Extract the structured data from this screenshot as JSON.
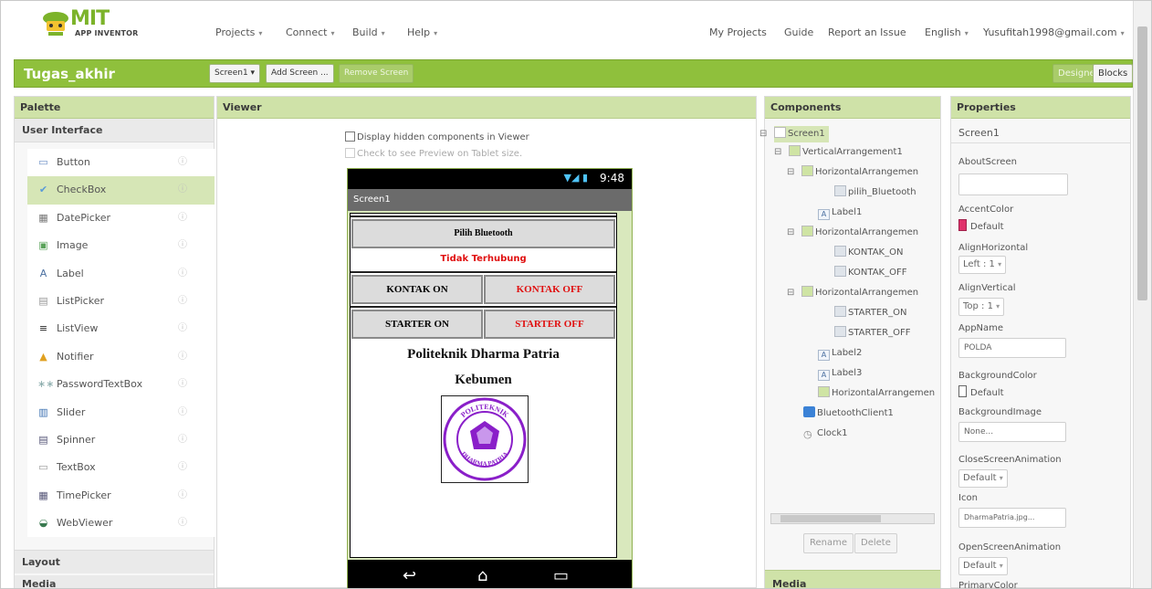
{
  "brand": {
    "logo_text": "MIT",
    "sub_text": "APP INVENTOR"
  },
  "top_menu": {
    "projects": "Projects",
    "connect": "Connect",
    "build": "Build",
    "help": "Help",
    "my_projects": "My Projects",
    "guide": "Guide",
    "report": "Report an Issue",
    "language": "English",
    "account": "Yusufitah1998@gmail.com"
  },
  "project_bar": {
    "name": "Tugas_akhir",
    "screen_select": "Screen1",
    "add_screen": "Add Screen ...",
    "remove_screen": "Remove Screen",
    "designer": "Designer",
    "blocks": "Blocks"
  },
  "palette": {
    "title": "Palette",
    "section": "User Interface",
    "items": [
      {
        "label": "Button",
        "icon": "button-icon"
      },
      {
        "label": "CheckBox",
        "icon": "checkbox-icon"
      },
      {
        "label": "DatePicker",
        "icon": "datepicker-icon"
      },
      {
        "label": "Image",
        "icon": "image-icon"
      },
      {
        "label": "Label",
        "icon": "label-icon"
      },
      {
        "label": "ListPicker",
        "icon": "listpicker-icon"
      },
      {
        "label": "ListView",
        "icon": "listview-icon"
      },
      {
        "label": "Notifier",
        "icon": "notifier-icon"
      },
      {
        "label": "PasswordTextBox",
        "icon": "password-icon"
      },
      {
        "label": "Slider",
        "icon": "slider-icon"
      },
      {
        "label": "Spinner",
        "icon": "spinner-icon"
      },
      {
        "label": "TextBox",
        "icon": "textbox-icon"
      },
      {
        "label": "TimePicker",
        "icon": "timepicker-icon"
      },
      {
        "label": "WebViewer",
        "icon": "webviewer-icon"
      }
    ],
    "help_glyph": "?",
    "layout": "Layout",
    "media": "Media"
  },
  "viewer": {
    "title": "Viewer",
    "hidden_check": "Display hidden components in Viewer",
    "tablet_check": "Check to see Preview on Tablet size.",
    "phone": {
      "time": "9:48",
      "screen_title": "Screen1",
      "pilih_bluetooth": "Pilih Bluetooth",
      "status": "Tidak Terhubung",
      "kontak_on": "KONTAK ON",
      "kontak_off": "KONTAK OFF",
      "starter_on": "STARTER ON",
      "starter_off": "STARTER OFF",
      "heading_1": "Politeknik Dharma Patria",
      "heading_2": "Kebumen",
      "logo_text_top": "POLITEKNIK",
      "logo_text_bottom": "DHARMA PATRIA"
    },
    "colors": {
      "status_red": "#e01010",
      "off_red": "#e01010",
      "logo_purple": "#8a1fc9"
    }
  },
  "components": {
    "title": "Components",
    "tree": [
      "Screen1",
      "VerticalArrangement1",
      "HorizontalArrangemen",
      "pilih_Bluetooth",
      "Label1",
      "HorizontalArrangemen",
      "KONTAK_ON",
      "KONTAK_OFF",
      "HorizontalArrangemen",
      "STARTER_ON",
      "STARTER_OFF",
      "Label2",
      "Label3",
      "HorizontalArrangemen",
      "BluetoothClient1",
      "Clock1"
    ],
    "rename": "Rename",
    "delete": "Delete",
    "media": "Media"
  },
  "properties": {
    "title": "Properties",
    "component": "Screen1",
    "about_screen": "AboutScreen",
    "accent_color": "AccentColor",
    "accent_value": "Default",
    "align_horizontal": "AlignHorizontal",
    "align_horizontal_value": "Left : 1",
    "align_vertical": "AlignVertical",
    "align_vertical_value": "Top : 1",
    "app_name": "AppName",
    "app_name_value": "POLDA",
    "background_color": "BackgroundColor",
    "background_color_value": "Default",
    "background_image": "BackgroundImage",
    "background_image_value": "None...",
    "close_anim": "CloseScreenAnimation",
    "close_anim_value": "Default",
    "icon": "Icon",
    "icon_value": "DharmaPatria.jpg...",
    "open_anim": "OpenScreenAnimation",
    "open_anim_value": "Default",
    "primary_color": "PrimaryColor",
    "accent_swatch": "#e0306a"
  }
}
